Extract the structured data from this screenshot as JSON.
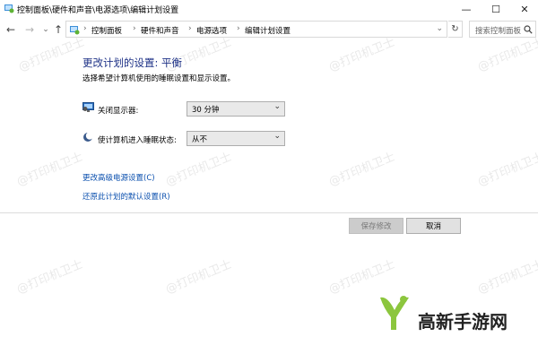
{
  "window": {
    "title": "控制面板\\硬件和声音\\电源选项\\编辑计划设置",
    "minimize_glyph": "—",
    "maximize_glyph": "☐",
    "close_glyph": "✕"
  },
  "nav": {
    "back_glyph": "←",
    "forward_glyph": "→",
    "dropdown_glyph": "⌄",
    "up_glyph": "↑"
  },
  "breadcrumb": {
    "items": [
      "控制面板",
      "硬件和声音",
      "电源选项",
      "编辑计划设置"
    ],
    "separator": "›"
  },
  "refresh_glyph": "↻",
  "search": {
    "placeholder": "搜索控制面板",
    "icon": "search-icon"
  },
  "main": {
    "heading": "更改计划的设置: 平衡",
    "subheading": "选择希望计算机使用的睡眠设置和显示设置。",
    "settings": [
      {
        "label": "关闭显示器:",
        "value": "30 分钟",
        "icon": "monitor-icon"
      },
      {
        "label": "使计算机进入睡眠状态:",
        "value": "从不",
        "icon": "moon-icon"
      }
    ],
    "links": {
      "advanced": "更改高级电源设置(C)",
      "restore": "还原此计划的默认设置(R)"
    }
  },
  "buttons": {
    "save": "保存修改",
    "cancel": "取消"
  },
  "watermark": "@打印机卫士",
  "brand": {
    "name": "高新手游网",
    "accent": "#8cc63e"
  },
  "colors": {
    "heading": "#1e3287",
    "link": "#0a4fae"
  }
}
